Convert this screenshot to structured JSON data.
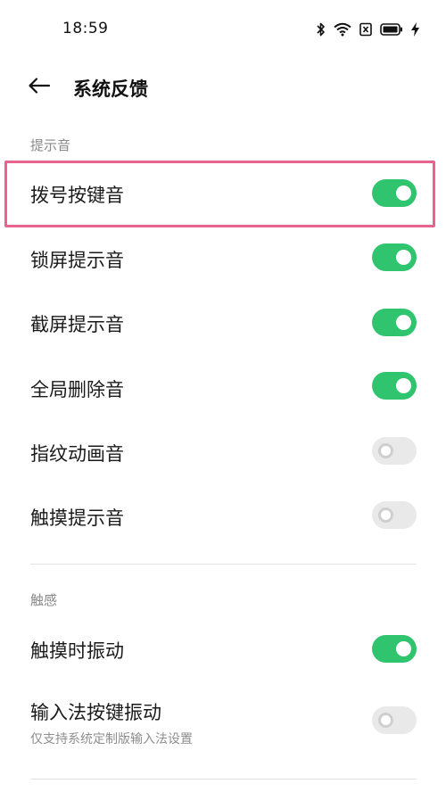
{
  "status_bar": {
    "time": "18:59",
    "icons": [
      "bluetooth-icon",
      "wifi-icon",
      "sim-off-icon",
      "battery-icon",
      "charging-icon"
    ]
  },
  "header": {
    "back_icon": "arrow-left-icon",
    "title": "系统反馈"
  },
  "sections": {
    "sound": {
      "title": "提示音",
      "items": [
        {
          "label": "拨号按键音",
          "on": true
        },
        {
          "label": "锁屏提示音",
          "on": true
        },
        {
          "label": "截屏提示音",
          "on": true
        },
        {
          "label": "全局删除音",
          "on": true
        },
        {
          "label": "指纹动画音",
          "on": false
        },
        {
          "label": "触摸提示音",
          "on": false
        }
      ]
    },
    "haptic": {
      "title": "触感",
      "items": [
        {
          "label": "触摸时振动",
          "on": true
        },
        {
          "label": "输入法按键振动",
          "sub": "仅支持系统定制版输入法设置",
          "on": false
        }
      ]
    }
  },
  "colors": {
    "toggle_on": "#2fc46d",
    "toggle_off": "#e9e9e9",
    "highlight": "#e8638d"
  }
}
